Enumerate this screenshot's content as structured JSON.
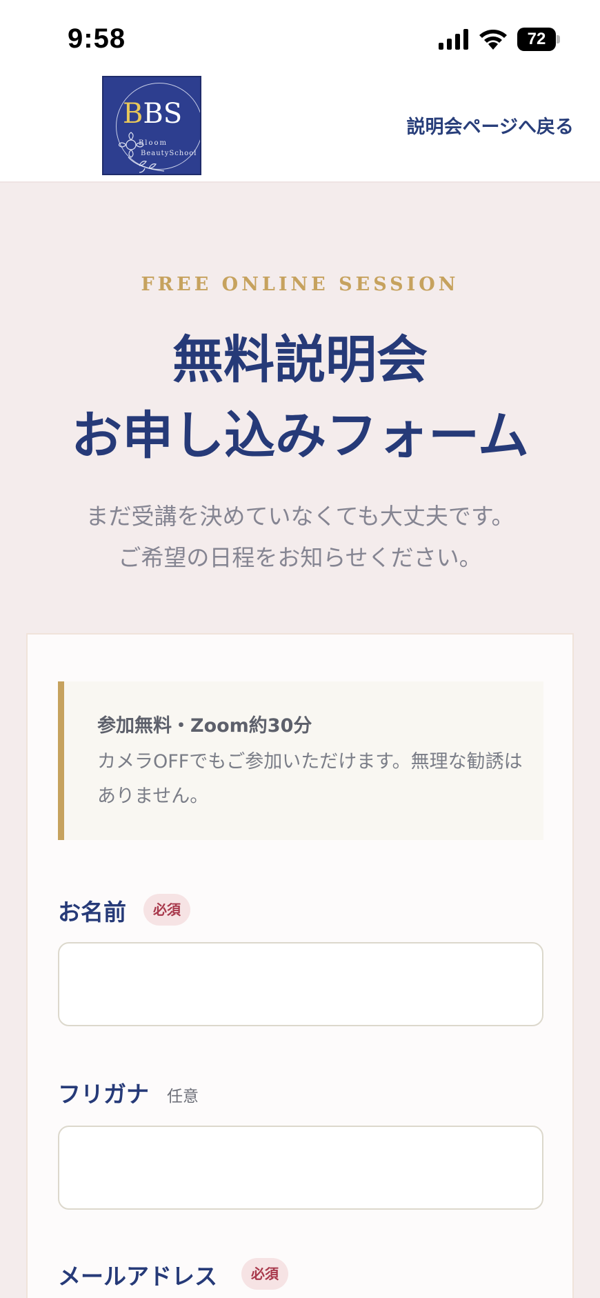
{
  "status_bar": {
    "time": "9:58",
    "battery_level": "72",
    "icons": [
      "signal-icon",
      "wifi-icon",
      "battery-icon"
    ]
  },
  "header": {
    "logo": {
      "mark_b": "B",
      "mark_rest": "BS",
      "line1": "Bloom",
      "line2": "BeautySchool"
    },
    "back_link_label": "説明会ページへ戻る"
  },
  "hero": {
    "eyebrow": "FREE ONLINE SESSION",
    "title": "無料説明会\nお申し込みフォーム",
    "subtitle": "まだ受講を決めていなくても大丈夫です。\nご希望の日程をお知らせください。"
  },
  "form": {
    "notice": {
      "title": "参加無料・Zoom約30分",
      "body": "カメラOFFでもご参加いただけます。無理な勧誘はありません。"
    },
    "fields": [
      {
        "label": "お名前",
        "badge": "必須",
        "value": "",
        "placeholder": ""
      },
      {
        "label": "フリガナ",
        "badge": "任意",
        "value": "",
        "placeholder": ""
      },
      {
        "label": "メールアドレス",
        "badge": "必須"
      }
    ]
  },
  "colors": {
    "navy": "#263a78",
    "gold": "#c6a25e",
    "required_badge_bg": "#f6e3e4",
    "required_badge_text": "#a8384b",
    "page_bg": "#f4ecec"
  }
}
